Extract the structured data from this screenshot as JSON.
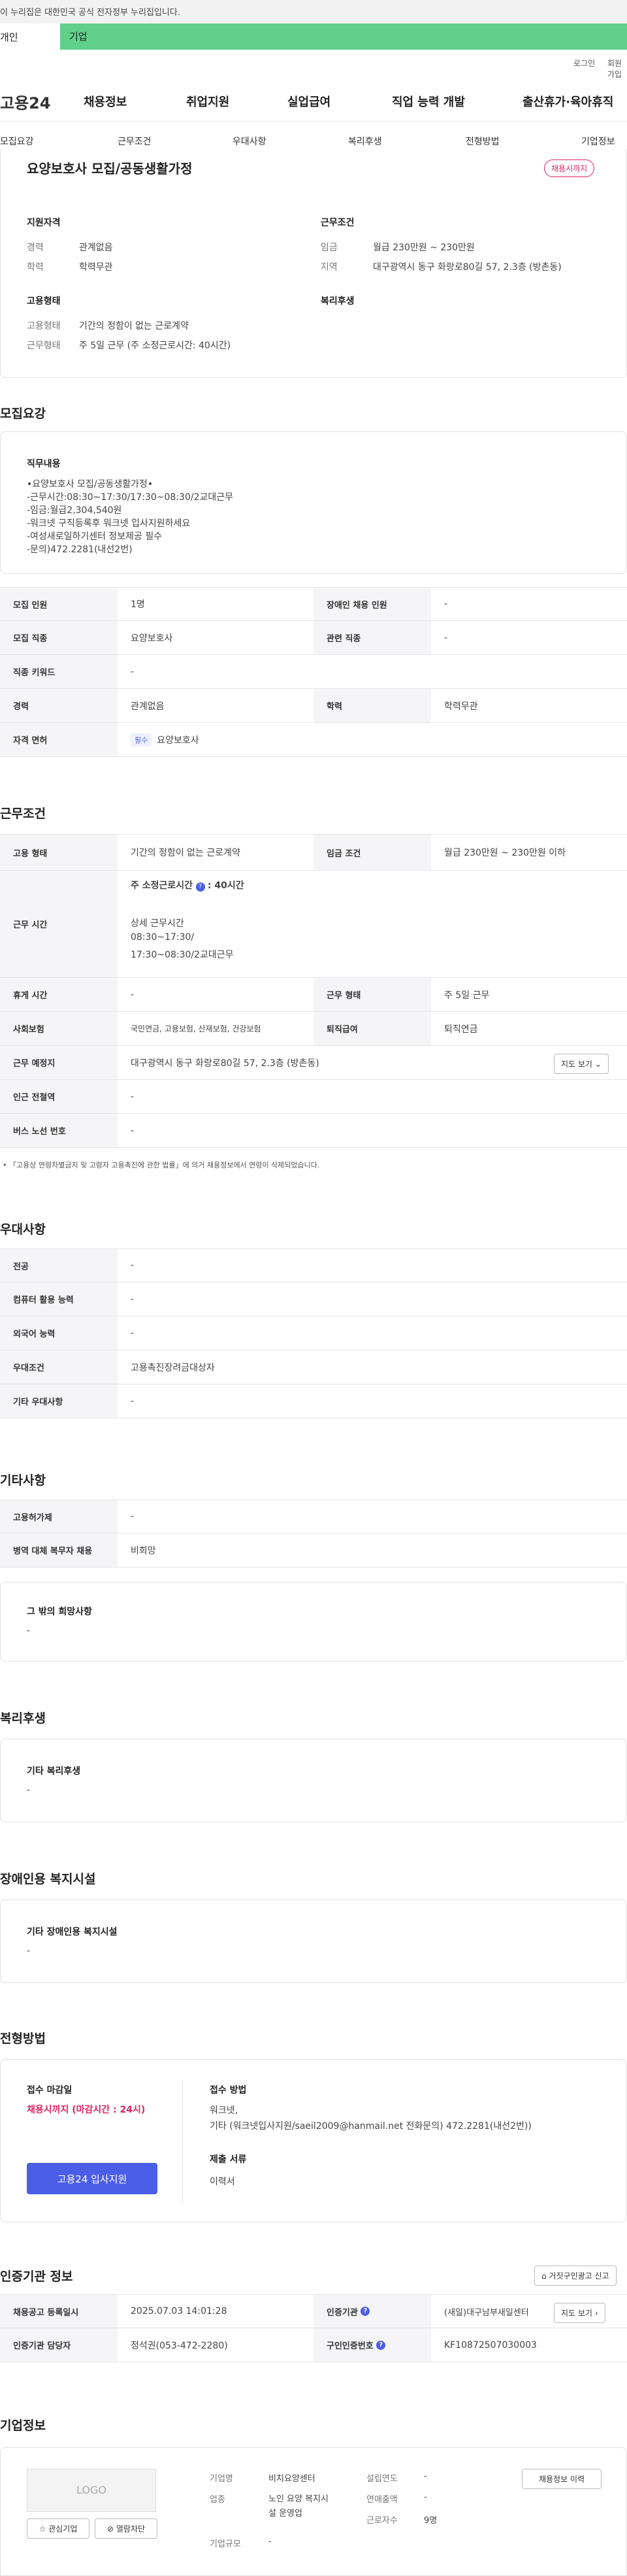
{
  "gov_banner": "이 누리집은 대한민국 공식 전자정부 누리집입니다.",
  "segments": {
    "individual": "개인",
    "company": "기업"
  },
  "util_links": [
    "로그인",
    "회원가입"
  ],
  "brand": "고용24",
  "gnb": [
    "채용정보",
    "취업지원",
    "실업급여",
    "직업 능력 개발",
    "출산휴가·육아휴직"
  ],
  "subnav": [
    "모집요강",
    "근무조건",
    "우대사항",
    "복리후생",
    "전형방법",
    "기업정보"
  ],
  "summary": {
    "title": "요양보호사 모집/공동생활가정",
    "status_badge": "채용시까지",
    "qualification_heading": "지원자격",
    "career_label": "경력",
    "career_value": "관계없음",
    "education_label": "학력",
    "education_value": "학력무관",
    "conditions_heading": "근무조건",
    "wage_label": "임금",
    "wage_value": "월급 230만원 ~ 230만원",
    "region_label": "지역",
    "region_value": "대구광역시 동구 화랑로80길 57, 2.3층 (방촌동)",
    "employment_heading": "고용형태",
    "emptype_label": "고용형태",
    "emptype_value": "기간의 정함이 없는 근로계약",
    "worktype_label": "근무형태",
    "worktype_value": "주 5일 근무 (주 소정근로시간: 40시간)",
    "welfare_heading": "복리후생"
  },
  "recruit": {
    "section_title": "모집요강",
    "duty_heading": "직무내용",
    "duty_lines": [
      "•요양보호사 모집/공동생활가정•",
      "-근무시간:08:30~17:30/17:30~08:30/2교대근무",
      "-임금:월급2,304,540원",
      "-워크넷 구직등록후 워크넷 입사지원하세요",
      "-여성새로일하기센터 정보제공 필수",
      "-문의)472.2281(내선2번)"
    ],
    "rows": [
      {
        "l1": "모집 인원",
        "v1": "1명",
        "l2": "장애인 채용 인원",
        "v2": "-"
      },
      {
        "l1": "모집 직종",
        "v1": "요양보호사",
        "l2": "관련 직종",
        "v2": "-"
      },
      {
        "l1": "직종 키워드",
        "v1": "-"
      },
      {
        "l1": "경력",
        "v1": "관계없음",
        "l2": "학력",
        "v2": "학력무관"
      },
      {
        "l1": "자격 면허",
        "chip": "필수",
        "v1": "요양보호사"
      }
    ]
  },
  "conditions": {
    "section_title": "근무조건",
    "emptype_label": "고용 형태",
    "emptype_value": "기간의 정함이 없는 근로계약",
    "wage_label": "임금 조건",
    "wage_value": "월급 230만원 ~ 230만원 이하",
    "hours_label": "근무 시간",
    "weekly_label": "주 소정근로시간",
    "weekly_value": ": 40시간",
    "detail_label": "상세 근무시간",
    "detail_lines": [
      "08:30~17:30/",
      "17:30~08:30/2교대근무"
    ],
    "break_label": "휴게 시간",
    "break_value": "-",
    "worktype_label": "근무 형태",
    "worktype_value": "주 5일 근무",
    "insurance_label": "사회보험",
    "insurance_value": "국민연금, 고용보험, 산재보험, 건강보험",
    "retire_label": "퇴직급여",
    "retire_value": "퇴직연금",
    "place_label": "근무 예정지",
    "place_value": "대구광역시 동구 화랑로80길 57, 2.3층 (방촌동)",
    "map_button": "지도 보기",
    "subway_label": "인근 전철역",
    "subway_value": "-",
    "bus_label": "버스 노선 번호",
    "bus_value": "-",
    "notice": "「고용상 연령차별금지 및 고령자 고용촉진에 관한 법률」에 의거 채용정보에서 연령이 삭제되었습니다."
  },
  "preference": {
    "section_title": "우대사항",
    "rows": [
      {
        "label": "전공",
        "value": "-"
      },
      {
        "label": "컴퓨터 활용 능력",
        "value": "-"
      },
      {
        "label": "외국어 능력",
        "value": "-"
      },
      {
        "label": "우대조건",
        "value": "고용촉진장려금대상자"
      },
      {
        "label": "기타 우대사항",
        "value": "-"
      }
    ]
  },
  "other": {
    "section_title": "기타사항",
    "rows": [
      {
        "label": "고용허가제",
        "value": "-"
      },
      {
        "label": "병역 대체 복무자 채용",
        "value": "비희망"
      }
    ],
    "etc_heading": "그 밖의 희망사항",
    "etc_value": "-"
  },
  "welfare": {
    "section_title": "복리후생",
    "heading": "기타 복리후생",
    "value": "-"
  },
  "disability": {
    "section_title": "장애인용 복지시설",
    "heading": "기타 장애인용 복지시설",
    "value": "-"
  },
  "selection": {
    "section_title": "전형방법",
    "deadline_heading": "접수 마감일",
    "deadline_value": "채용시까지 (마감시간 : 24시)",
    "apply_button": "고용24 입사지원",
    "method_heading": "접수 방법",
    "method_lines": [
      "워크넷,",
      "기타 (워크넷입사지원/saeil2009@hanmail.net 전화문의) 472.2281(내선2번))"
    ],
    "docs_heading": "제출 서류",
    "docs_value": "이력서"
  },
  "cert": {
    "section_title": "인증기관 정보",
    "report_button": "거짓구인광고 신고",
    "rows": [
      {
        "l1": "채용공고 등록일시",
        "v1": "2025.07.03 14:01:28",
        "l2": "인증기관",
        "v2": "(새일)대구남부새일센터",
        "btn": "지도 보기"
      },
      {
        "l1": "인증기관 담당자",
        "v1": "정석권(053-472-2280)",
        "l2": "구인인증번호",
        "v2": "KF10872507030003"
      }
    ]
  },
  "company": {
    "section_title": "기업정보",
    "logo_text": "LOGO",
    "interest_button": "관심기업",
    "block_button": "열람차단",
    "name_label": "기업명",
    "name_value": "비치요양센터",
    "industry_label": "업종",
    "industry_lines": [
      "노인 요양 복지시",
      "설 운영업"
    ],
    "size_label": "기업규모",
    "size_value": "-",
    "founded_label": "설립연도",
    "founded_value": "-",
    "revenue_label": "연매출액",
    "revenue_value": "-",
    "staff_label": "근로자수",
    "staff_value": "9명",
    "history_button": "채용정보 이력"
  },
  "colors": {
    "accent_green": "#5fd18a",
    "primary_blue": "#4b5ee8",
    "deadline_red": "#e0245e"
  }
}
